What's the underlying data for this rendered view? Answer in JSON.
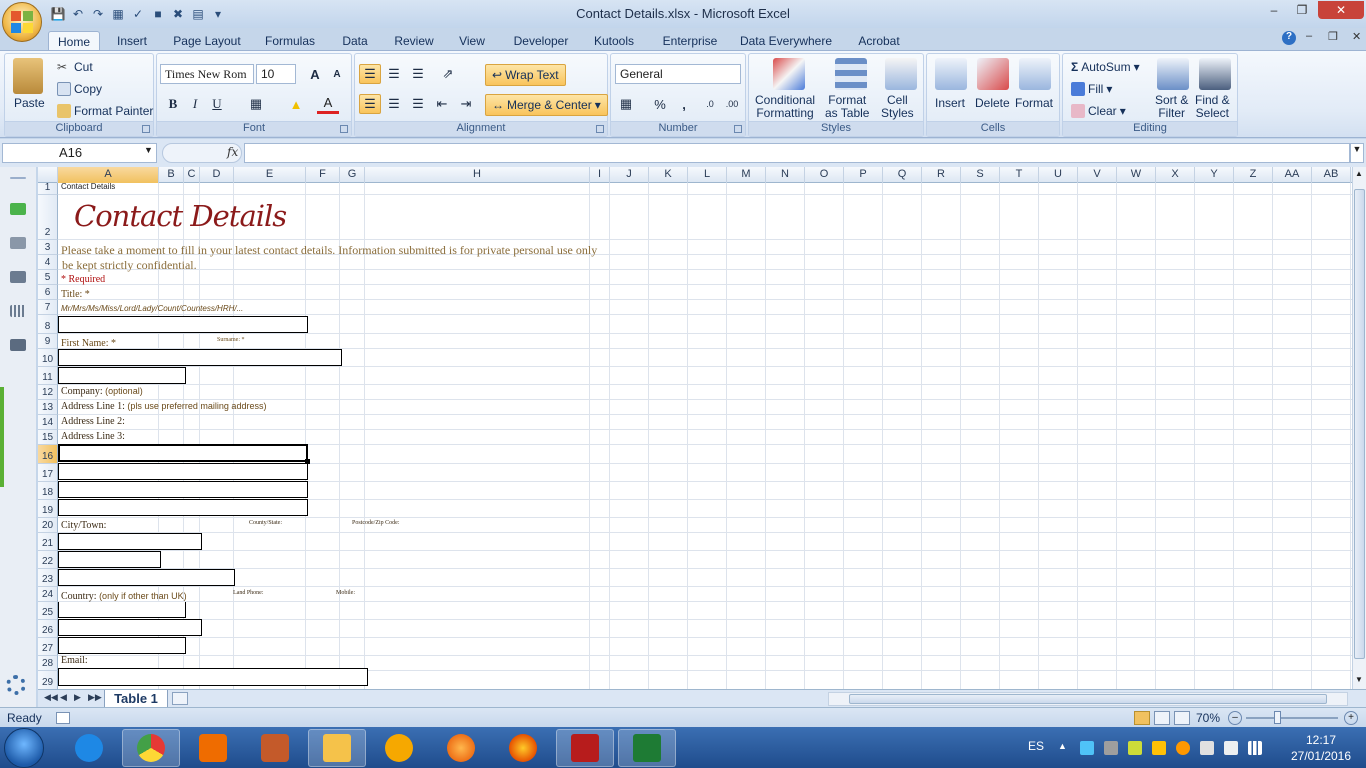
{
  "window": {
    "title": "Contact Details.xlsx - Microsoft Excel",
    "minimize": "–",
    "restore": "❐",
    "close": "✕"
  },
  "ribbon_tabs": [
    "Home",
    "Insert",
    "Page Layout",
    "Formulas",
    "Data",
    "Review",
    "View",
    "Developer",
    "Kutools",
    "Enterprise",
    "Data Everywhere",
    "Acrobat"
  ],
  "clipboard": {
    "paste": "Paste",
    "cut": "Cut",
    "copy": "Copy",
    "format_painter": "Format Painter",
    "label": "Clipboard"
  },
  "font": {
    "name": "Times New Rom",
    "size": "10",
    "bold": "B",
    "italic": "I",
    "underline": "U",
    "grow": "A",
    "shrink": "A",
    "color_letter": "A",
    "label": "Font"
  },
  "alignment": {
    "wrap_text": "Wrap Text",
    "merge_center": "Merge & Center",
    "label": "Alignment"
  },
  "number": {
    "format": "General",
    "percent": "%",
    "comma": ",",
    "label": "Number"
  },
  "styles": {
    "conditional_1": "Conditional",
    "conditional_2": "Formatting",
    "table_1": "Format",
    "table_2": "as Table",
    "cell_1": "Cell",
    "cell_2": "Styles",
    "label": "Styles"
  },
  "cells": {
    "insert": "Insert",
    "delete": "Delete",
    "format": "Format",
    "label": "Cells"
  },
  "editing": {
    "autosum": "AutoSum",
    "fill": "Fill",
    "clear": "Clear",
    "sort_1": "Sort &",
    "sort_2": "Filter",
    "find_1": "Find &",
    "find_2": "Select",
    "label": "Editing"
  },
  "formula_bar": {
    "name_box": "A16",
    "fx": "fx",
    "value": ""
  },
  "columns": [
    "A",
    "B",
    "C",
    "D",
    "E",
    "F",
    "G",
    "H",
    "I",
    "J",
    "K",
    "L",
    "M",
    "N",
    "O",
    "P",
    "Q",
    "R",
    "S",
    "T",
    "U",
    "V",
    "W",
    "X",
    "Y",
    "Z",
    "AA",
    "AB"
  ],
  "rows": [
    "1",
    "2",
    "3",
    "4",
    "5",
    "6",
    "7",
    "8",
    "9",
    "10",
    "11",
    "12",
    "13",
    "14",
    "15",
    "16",
    "17",
    "18",
    "19",
    "20",
    "21",
    "22",
    "23",
    "24",
    "25",
    "26",
    "27",
    "28",
    "29"
  ],
  "sheet": {
    "a1": "Contact Details",
    "title": "Contact Details",
    "intro_1": "Please take a moment to fill in your latest contact details. Information submitted is for private personal use only",
    "intro_2": "be kept strictly confidential.",
    "required": "* Required",
    "title_label": "Title: *",
    "title_options": "Mr/Mrs/Ms/Miss/Lord/Lady/Count/Countess/HRH/...",
    "first_name": "First Name: *",
    "surname": "Surname: *",
    "company": "Company:",
    "company_note": "(optional)",
    "address1": "Address Line 1:",
    "address1_note": "(pls use preferred mailing address)",
    "address2": "Address Line 2:",
    "address3": "Address Line 3:",
    "city": "City/Town:",
    "county": "County/State:",
    "postcode": "Postcode/Zip Code:",
    "country": "Country:",
    "country_note": "(only if other than UK)",
    "land_phone": "Land Phone:",
    "mobile": "Mobile:",
    "email": "Email:"
  },
  "sheet_tabs": [
    "Table 1"
  ],
  "status": {
    "ready": "Ready",
    "zoom": "70%"
  },
  "taskbar": {
    "lang": "ES",
    "time": "12:17",
    "date": "27/01/2016"
  },
  "colors": {
    "accent": "#f1c15f",
    "title_red": "#8b1a1a",
    "intro_brown": "#8a6d3b",
    "ribbon_blue": "#15305a"
  }
}
